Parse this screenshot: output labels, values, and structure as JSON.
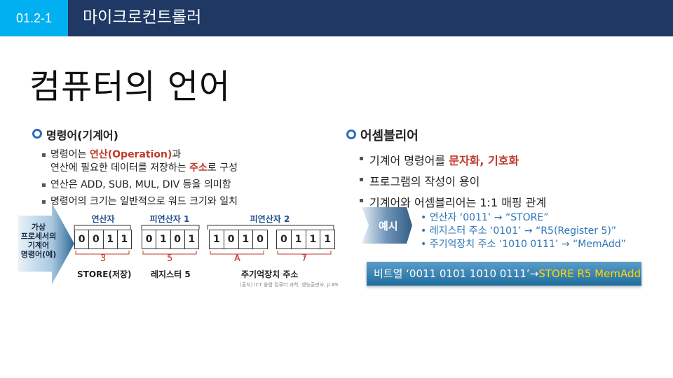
{
  "header": {
    "badge": "01.2-1",
    "title": "마이크로컨트롤러"
  },
  "heading": "컴퓨터의 언어",
  "left": {
    "title": "명령어(기계어)",
    "b1_pre": "명령어는 ",
    "b1_red": "연산(Operation)",
    "b1_post": "과",
    "b1_line2_pre": "연산에 필요한 데이터를  저장하는 ",
    "b1_line2_red": "주소",
    "b1_line2_post": "로 구성",
    "b2": "연산은 ADD, SUB, MUL, DIV 등을 의미함",
    "b3": "명령어의 크기는 일반적으로 워드 크기와 일치",
    "diagram": {
      "arrow_text": "가상\n프로세서의\n기계어\n명령어(예)",
      "col1": "연산자",
      "col2": "피연산자 1",
      "col3": "피연산자 2",
      "box1": [
        "0",
        "0",
        "1",
        "1"
      ],
      "box2": [
        "0",
        "1",
        "0",
        "1"
      ],
      "box3": [
        "1",
        "0",
        "1",
        "0"
      ],
      "box4": [
        "0",
        "1",
        "1",
        "1"
      ],
      "n1": "3",
      "n2": "5",
      "n3": "A",
      "n4": "7",
      "cap1": "STORE(저장)",
      "cap2": "레지스터 5",
      "cap3": "주기억장치 주소",
      "source": "(출처) ICT 융합 컴퓨터 과학, 생능출판사, p.89"
    }
  },
  "right": {
    "title": "어셈블리어",
    "b1_pre": "기계어 명령어를 ",
    "b1_red": "문자화, 기호화",
    "b2": "프로그램의 작성이 용이",
    "b3": "기계어와 어셈블리어는 1:1 매핑 관계",
    "example_label": "예시",
    "examples": [
      "연산자 ‘0011’  →  “STORE”",
      "레지스터 주소 ‘0101’  →  “R5(Register 5)”",
      "주기억장치 주소 ‘1010 0111’  →  “MemAdd”"
    ],
    "bitstring_pre": "비트열 ‘0011 0101 1010 0111’→",
    "bitstring_hl": "STORE R5 MemAdd"
  },
  "colors": {
    "topbar": "#1f3864",
    "badge": "#00b0f0",
    "accent_red": "#c0392b",
    "example_blue": "#2e75b6",
    "highlight": "#ffd700"
  }
}
